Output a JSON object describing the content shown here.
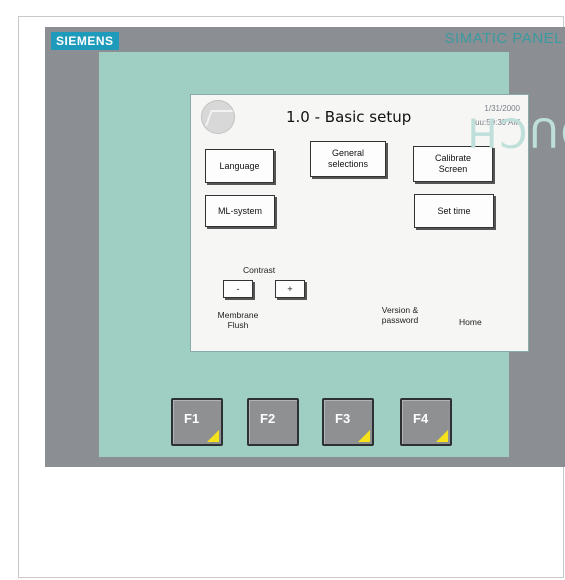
{
  "panel": {
    "brand": "SIEMENS",
    "product": "SIMATIC PANEL",
    "touch": "TOUCH"
  },
  "screen": {
    "title": "1.0 - Basic setup",
    "date": "1/31/2000",
    "time": "uu:59:39 AM",
    "buttons": {
      "language": "Language",
      "general_selections": "General selections",
      "calibrate_screen": "Calibrate Screen",
      "ml_system": "ML-system",
      "set_time": "Set time",
      "contrast_minus": "-",
      "contrast_plus": "+"
    },
    "labels": {
      "contrast": "Contrast",
      "membrane_flush": "Membrane Flush",
      "version_password": "Version & password",
      "home": "Home"
    }
  },
  "function_keys": [
    "F1",
    "F2",
    "F3",
    "F4"
  ],
  "colors": {
    "brand_teal": "#1e9bbb",
    "bezel": "#9fcfc3",
    "panel_gray": "#8b8f93",
    "key_accent": "#f4e21a"
  }
}
